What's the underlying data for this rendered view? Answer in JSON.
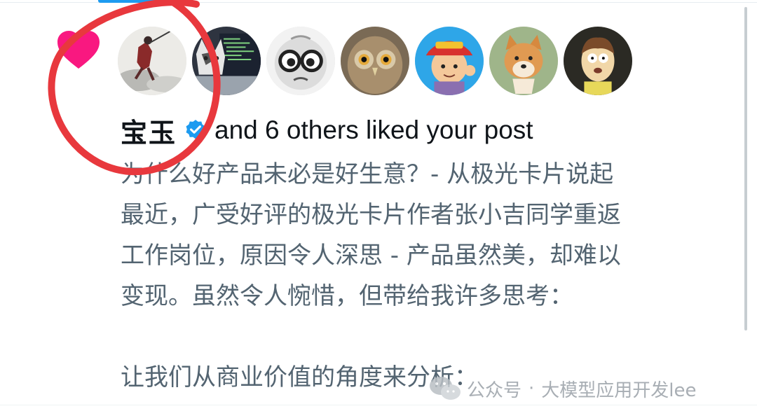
{
  "notification": {
    "liker_name": "宝玉",
    "liked_rest": "and 6 others liked your post",
    "avatars": [
      {
        "name": "宝玉",
        "icon": "ink-painting-warrior-avatar"
      },
      {
        "name": "",
        "icon": "husky-laptop-avatar"
      },
      {
        "name": "",
        "icon": "baby-glasses-avatar"
      },
      {
        "name": "",
        "icon": "owl-avatar"
      },
      {
        "name": "",
        "icon": "summer-cap-boy-avatar"
      },
      {
        "name": "",
        "icon": "shiba-dog-avatar"
      },
      {
        "name": "",
        "icon": "cartoon-character-avatar"
      }
    ],
    "post_lines": [
      "为什么好产品未必是好生意？- 从极光卡片说起",
      "最近，广受好评的极光卡片作者张小吉同学重返",
      "工作岗位，原因令人深思 - 产品虽然美，却难以",
      "变现。虽然令人惋惜，但带给我许多思考：",
      "",
      "让我们从商业价值的角度来分析："
    ]
  },
  "watermark": {
    "prefix": "公众号",
    "separator": "·",
    "account": "大模型应用开发lee"
  },
  "colors": {
    "heart": "#f91880",
    "verified": "#1d9bf0",
    "annotation": "#e8383d",
    "text_primary": "#0f1419",
    "text_secondary": "#536471"
  }
}
